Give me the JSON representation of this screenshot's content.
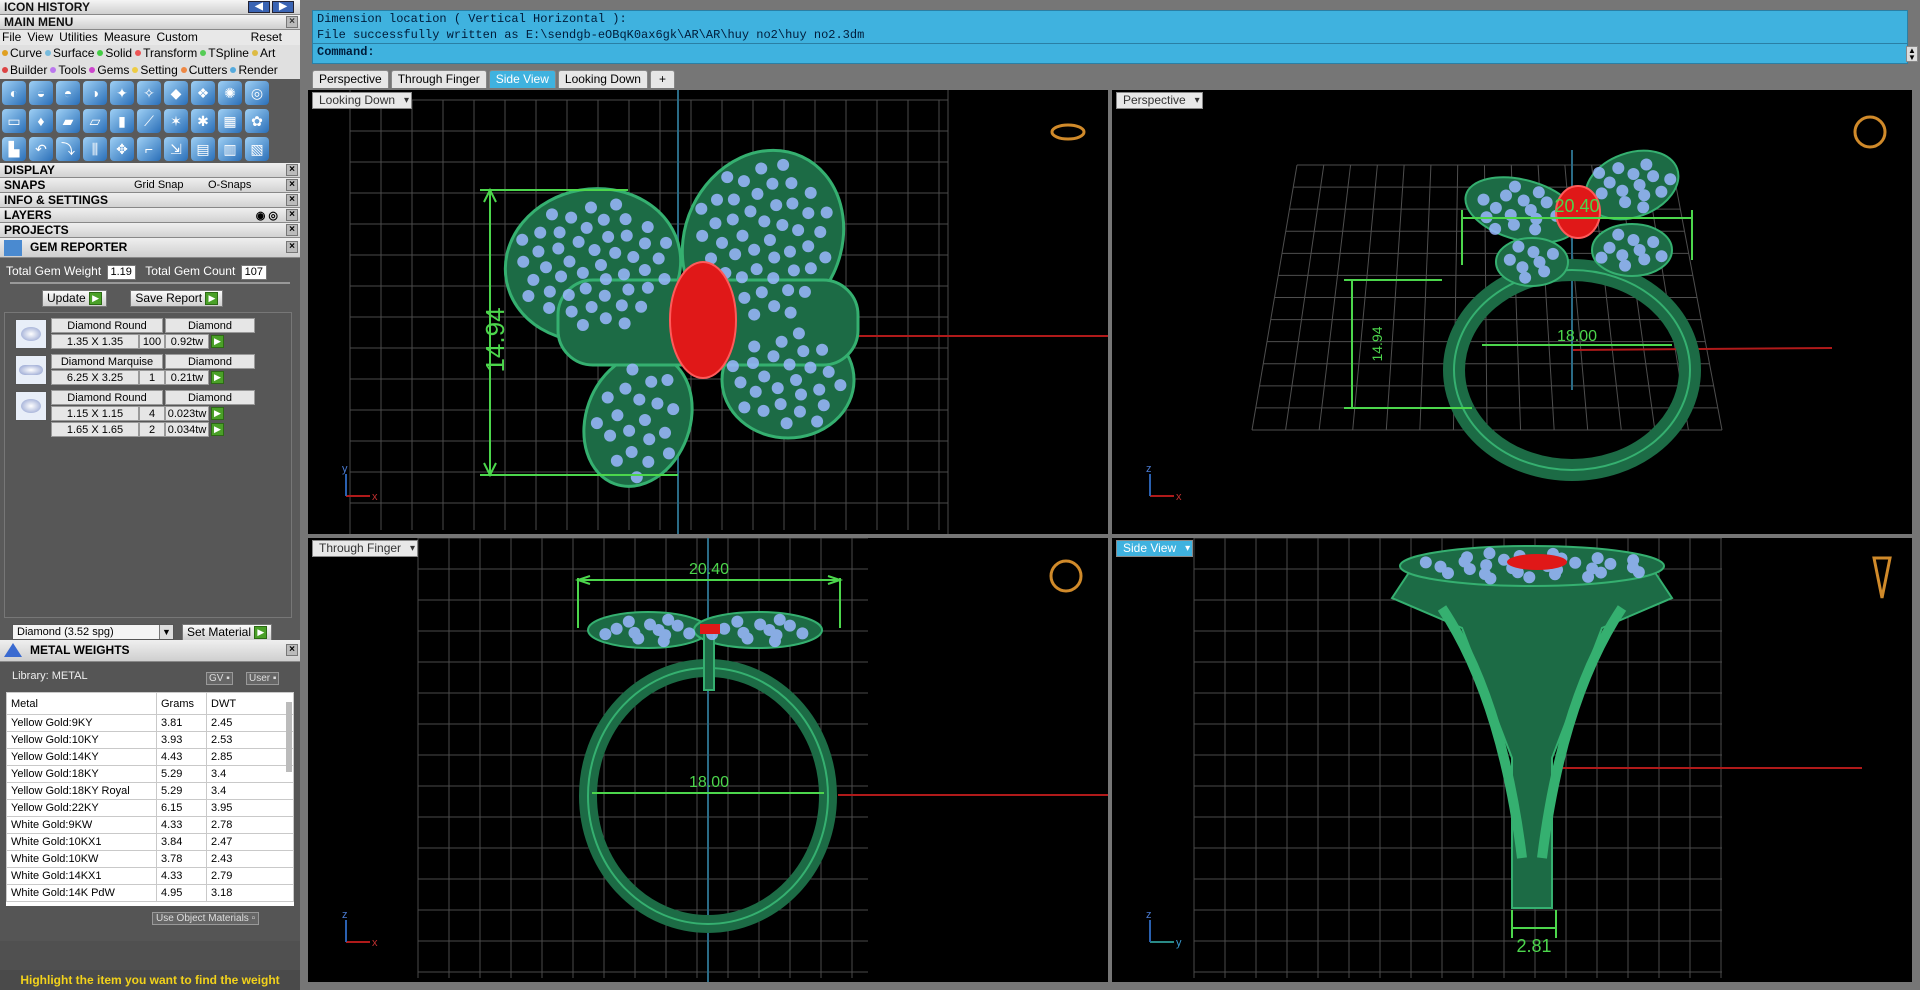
{
  "left": {
    "icon_history": "ICON HISTORY",
    "main_menu": "MAIN MENU",
    "menu": [
      "File",
      "View",
      "Utilities",
      "Measure",
      "Custom"
    ],
    "reset": "Reset",
    "cats1": [
      "Curve",
      "Surface",
      "Solid",
      "Transform",
      "TSpline",
      "Art"
    ],
    "cats2": [
      "Builder",
      "Tools",
      "Gems",
      "Setting",
      "Cutters",
      "Render"
    ],
    "sections": [
      "DISPLAY",
      "SNAPS",
      "INFO & SETTINGS",
      "LAYERS",
      "PROJECTS"
    ],
    "grid_snap": "Grid Snap",
    "o_snaps": "O-Snaps",
    "gem_reporter": {
      "title": "GEM REPORTER",
      "total_weight_label": "Total Gem Weight",
      "total_weight": "1.19",
      "total_count_label": "Total Gem Count",
      "total_count": "107",
      "update": "Update",
      "save_report": "Save Report",
      "gems": [
        {
          "shape": "Diamond Round",
          "material": "Diamond",
          "rows": [
            {
              "size": "1.35 X 1.35",
              "count": "100",
              "weight": "0.92tw"
            }
          ]
        },
        {
          "shape": "Diamond Marquise",
          "material": "Diamond",
          "rows": [
            {
              "size": "6.25 X 3.25",
              "count": "1",
              "weight": "0.21tw"
            }
          ]
        },
        {
          "shape": "Diamond Round",
          "material": "Diamond",
          "rows": [
            {
              "size": "1.15 X 1.15",
              "count": "4",
              "weight": "0.023tw"
            },
            {
              "size": "1.65 X 1.65",
              "count": "2",
              "weight": "0.034tw"
            }
          ]
        }
      ],
      "material_select": "Diamond    (3.52 spg)",
      "set_material": "Set Material"
    },
    "metal_weights": {
      "title": "METAL WEIGHTS",
      "library": "Library: METAL",
      "gv": "GV",
      "user": "User",
      "headers": [
        "Metal",
        "Grams",
        "DWT"
      ],
      "rows": [
        [
          "Yellow Gold:9KY",
          "3.81",
          "2.45"
        ],
        [
          "Yellow Gold:10KY",
          "3.93",
          "2.53"
        ],
        [
          "Yellow Gold:14KY",
          "4.43",
          "2.85"
        ],
        [
          "Yellow Gold:18KY",
          "5.29",
          "3.4"
        ],
        [
          "Yellow Gold:18KY Royal",
          "5.29",
          "3.4"
        ],
        [
          "Yellow Gold:22KY",
          "6.15",
          "3.95"
        ],
        [
          "White Gold:9KW",
          "4.33",
          "2.78"
        ],
        [
          "White Gold:10KX1",
          "3.84",
          "2.47"
        ],
        [
          "White Gold:10KW",
          "3.78",
          "2.43"
        ],
        [
          "White Gold:14KX1",
          "4.33",
          "2.79"
        ],
        [
          "White Gold:14K PdW",
          "4.95",
          "3.18"
        ]
      ],
      "use_object_materials": "Use Object Materials"
    },
    "status": "Highlight the item you want to find the weight"
  },
  "command": {
    "line1": "Dimension location ( Vertical  Horizontal ):",
    "line2": "File successfully written as E:\\sendgb-eOBqK0ax6gk\\AR\\AR\\huy no2\\huy no2.3dm",
    "label": "Command:"
  },
  "tabs": [
    "Perspective",
    "Through Finger",
    "Side View",
    "Looking Down"
  ],
  "viewports": {
    "top_left": {
      "label": "Looking Down",
      "dim_v": "14.94"
    },
    "top_right": {
      "label": "Perspective",
      "dim_top": "20.40",
      "dim_mid": "18.00",
      "dim_v": "14.94"
    },
    "bottom_left": {
      "label": "Through Finger",
      "dim_top": "20.40",
      "dim_mid": "18.00"
    },
    "bottom_right": {
      "label": "Side View",
      "dim_bottom": "2.81"
    }
  },
  "colors": {
    "accent": "#3fb2df",
    "metal": "#1f7a4a",
    "gem": "#e01818",
    "stone": "#9bb8ff",
    "dim": "#4cd64c"
  }
}
